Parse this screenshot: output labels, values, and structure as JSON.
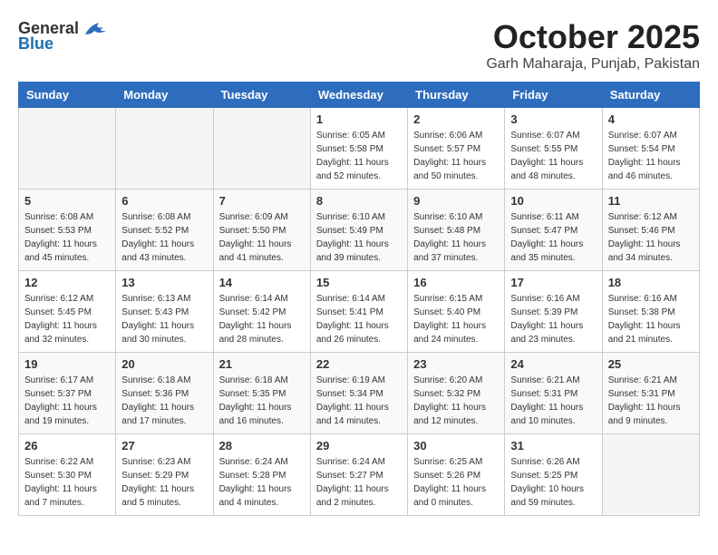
{
  "logo": {
    "general": "General",
    "blue": "Blue"
  },
  "title": "October 2025",
  "location": "Garh Maharaja, Punjab, Pakistan",
  "weekdays": [
    "Sunday",
    "Monday",
    "Tuesday",
    "Wednesday",
    "Thursday",
    "Friday",
    "Saturday"
  ],
  "days": [
    {
      "num": "",
      "info": ""
    },
    {
      "num": "",
      "info": ""
    },
    {
      "num": "",
      "info": ""
    },
    {
      "num": "1",
      "info": "Sunrise: 6:05 AM\nSunset: 5:58 PM\nDaylight: 11 hours and 52 minutes."
    },
    {
      "num": "2",
      "info": "Sunrise: 6:06 AM\nSunset: 5:57 PM\nDaylight: 11 hours and 50 minutes."
    },
    {
      "num": "3",
      "info": "Sunrise: 6:07 AM\nSunset: 5:55 PM\nDaylight: 11 hours and 48 minutes."
    },
    {
      "num": "4",
      "info": "Sunrise: 6:07 AM\nSunset: 5:54 PM\nDaylight: 11 hours and 46 minutes."
    },
    {
      "num": "5",
      "info": "Sunrise: 6:08 AM\nSunset: 5:53 PM\nDaylight: 11 hours and 45 minutes."
    },
    {
      "num": "6",
      "info": "Sunrise: 6:08 AM\nSunset: 5:52 PM\nDaylight: 11 hours and 43 minutes."
    },
    {
      "num": "7",
      "info": "Sunrise: 6:09 AM\nSunset: 5:50 PM\nDaylight: 11 hours and 41 minutes."
    },
    {
      "num": "8",
      "info": "Sunrise: 6:10 AM\nSunset: 5:49 PM\nDaylight: 11 hours and 39 minutes."
    },
    {
      "num": "9",
      "info": "Sunrise: 6:10 AM\nSunset: 5:48 PM\nDaylight: 11 hours and 37 minutes."
    },
    {
      "num": "10",
      "info": "Sunrise: 6:11 AM\nSunset: 5:47 PM\nDaylight: 11 hours and 35 minutes."
    },
    {
      "num": "11",
      "info": "Sunrise: 6:12 AM\nSunset: 5:46 PM\nDaylight: 11 hours and 34 minutes."
    },
    {
      "num": "12",
      "info": "Sunrise: 6:12 AM\nSunset: 5:45 PM\nDaylight: 11 hours and 32 minutes."
    },
    {
      "num": "13",
      "info": "Sunrise: 6:13 AM\nSunset: 5:43 PM\nDaylight: 11 hours and 30 minutes."
    },
    {
      "num": "14",
      "info": "Sunrise: 6:14 AM\nSunset: 5:42 PM\nDaylight: 11 hours and 28 minutes."
    },
    {
      "num": "15",
      "info": "Sunrise: 6:14 AM\nSunset: 5:41 PM\nDaylight: 11 hours and 26 minutes."
    },
    {
      "num": "16",
      "info": "Sunrise: 6:15 AM\nSunset: 5:40 PM\nDaylight: 11 hours and 24 minutes."
    },
    {
      "num": "17",
      "info": "Sunrise: 6:16 AM\nSunset: 5:39 PM\nDaylight: 11 hours and 23 minutes."
    },
    {
      "num": "18",
      "info": "Sunrise: 6:16 AM\nSunset: 5:38 PM\nDaylight: 11 hours and 21 minutes."
    },
    {
      "num": "19",
      "info": "Sunrise: 6:17 AM\nSunset: 5:37 PM\nDaylight: 11 hours and 19 minutes."
    },
    {
      "num": "20",
      "info": "Sunrise: 6:18 AM\nSunset: 5:36 PM\nDaylight: 11 hours and 17 minutes."
    },
    {
      "num": "21",
      "info": "Sunrise: 6:18 AM\nSunset: 5:35 PM\nDaylight: 11 hours and 16 minutes."
    },
    {
      "num": "22",
      "info": "Sunrise: 6:19 AM\nSunset: 5:34 PM\nDaylight: 11 hours and 14 minutes."
    },
    {
      "num": "23",
      "info": "Sunrise: 6:20 AM\nSunset: 5:32 PM\nDaylight: 11 hours and 12 minutes."
    },
    {
      "num": "24",
      "info": "Sunrise: 6:21 AM\nSunset: 5:31 PM\nDaylight: 11 hours and 10 minutes."
    },
    {
      "num": "25",
      "info": "Sunrise: 6:21 AM\nSunset: 5:31 PM\nDaylight: 11 hours and 9 minutes."
    },
    {
      "num": "26",
      "info": "Sunrise: 6:22 AM\nSunset: 5:30 PM\nDaylight: 11 hours and 7 minutes."
    },
    {
      "num": "27",
      "info": "Sunrise: 6:23 AM\nSunset: 5:29 PM\nDaylight: 11 hours and 5 minutes."
    },
    {
      "num": "28",
      "info": "Sunrise: 6:24 AM\nSunset: 5:28 PM\nDaylight: 11 hours and 4 minutes."
    },
    {
      "num": "29",
      "info": "Sunrise: 6:24 AM\nSunset: 5:27 PM\nDaylight: 11 hours and 2 minutes."
    },
    {
      "num": "30",
      "info": "Sunrise: 6:25 AM\nSunset: 5:26 PM\nDaylight: 11 hours and 0 minutes."
    },
    {
      "num": "31",
      "info": "Sunrise: 6:26 AM\nSunset: 5:25 PM\nDaylight: 10 hours and 59 minutes."
    },
    {
      "num": "",
      "info": ""
    }
  ]
}
